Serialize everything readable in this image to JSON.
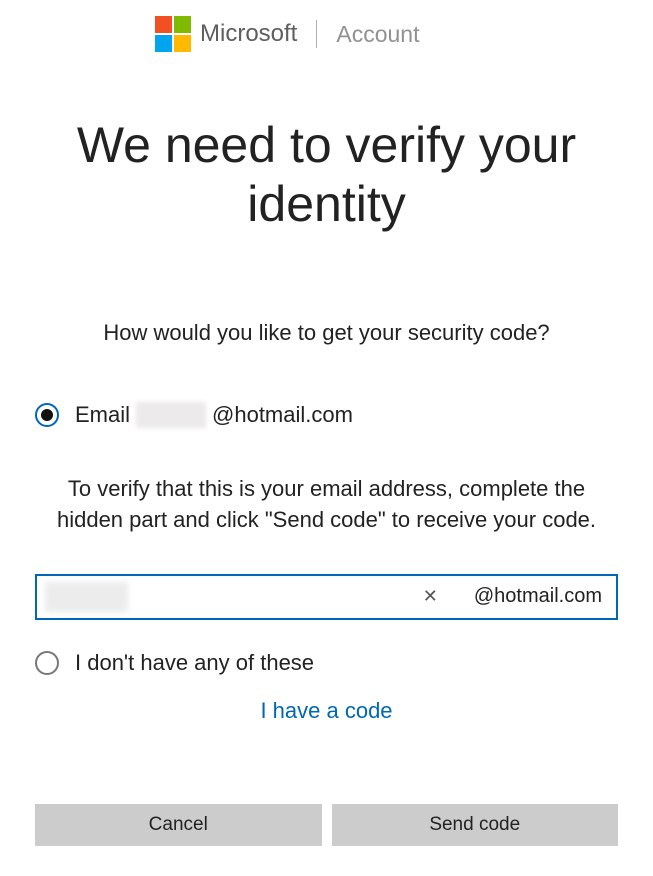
{
  "header": {
    "brand": "Microsoft",
    "section": "Account"
  },
  "title": "We need to verify your identity",
  "subtitle": "How would you like to get your security code?",
  "option_email": {
    "prefix": "Email",
    "domain": "@hotmail.com",
    "selected": true
  },
  "instruction": "To verify that this is your email address, complete the hidden part and click \"Send code\" to receive your code.",
  "input": {
    "value": "",
    "suffix": "@hotmail.com",
    "clear_glyph": "✕"
  },
  "option_none": {
    "label": "I don't have any of these",
    "selected": false
  },
  "link": "I have a code",
  "buttons": {
    "cancel": "Cancel",
    "send": "Send code"
  },
  "colors": {
    "accent": "#0067b8",
    "button_bg": "#cccccc"
  }
}
